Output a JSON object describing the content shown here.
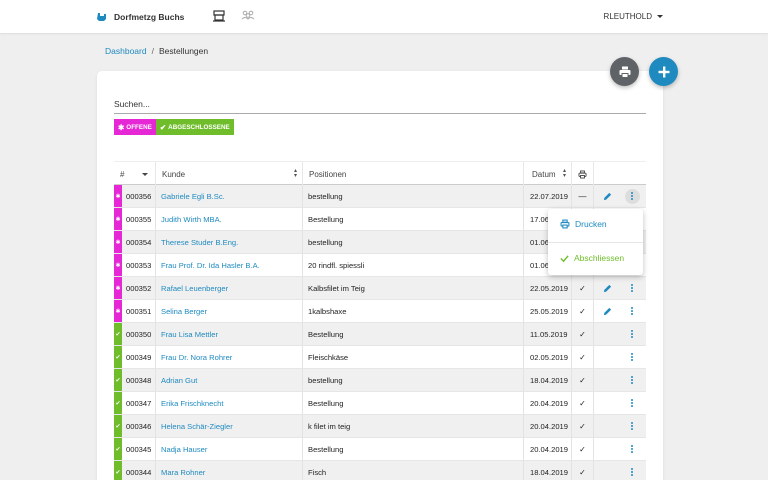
{
  "nav": {
    "brand": "Dorfmetzg Buchs",
    "user": "RLEUTHOLD"
  },
  "breadcrumb": {
    "home": "Dashboard",
    "separator": "/",
    "current": "Bestellungen"
  },
  "search": {
    "placeholder": "Suchen..."
  },
  "filters": {
    "open_label": "OFFENE",
    "closed_label": "ABGESCHLOSSENE"
  },
  "table": {
    "headers": {
      "number": "#",
      "customer": "Kunde",
      "positions": "Positionen",
      "date": "Datum"
    },
    "rows": [
      {
        "status": "open",
        "number": "000356",
        "customer": "Gabriele Egli B.Sc.",
        "positions": "bestellung",
        "date": "22.07.2019",
        "printed": "—",
        "editable": true,
        "menu_open": true
      },
      {
        "status": "open",
        "number": "000355",
        "customer": "Judith Wirth MBA.",
        "positions": "Bestellung",
        "date": "17.06",
        "printed": "",
        "editable": false
      },
      {
        "status": "open",
        "number": "000354",
        "customer": "Therese Studer B.Eng.",
        "positions": "bestellung",
        "date": "01.06",
        "printed": "",
        "editable": false
      },
      {
        "status": "open",
        "number": "000353",
        "customer": "Frau Prof. Dr. Ida Hasler B.A.",
        "positions": "20 rindfl. spiessli",
        "date": "01.06",
        "printed": "",
        "editable": false
      },
      {
        "status": "open",
        "number": "000352",
        "customer": "Rafael Leuenberger",
        "positions": "Kalbsfilet im Teig",
        "date": "22.05.2019",
        "printed": "✓",
        "editable": true
      },
      {
        "status": "open",
        "number": "000351",
        "customer": "Selina Berger",
        "positions": "1kalbshaxe",
        "date": "25.05.2019",
        "printed": "✓",
        "editable": true
      },
      {
        "status": "closed",
        "number": "000350",
        "customer": "Frau Lisa Mettler",
        "positions": "Bestellung",
        "date": "11.05.2019",
        "printed": "✓",
        "editable": false
      },
      {
        "status": "closed",
        "number": "000349",
        "customer": "Frau Dr. Nora Rohrer",
        "positions": "Fleischkäse",
        "date": "02.05.2019",
        "printed": "✓",
        "editable": false
      },
      {
        "status": "closed",
        "number": "000348",
        "customer": "Adrian Gut",
        "positions": "bestellung",
        "date": "18.04.2019",
        "printed": "✓",
        "editable": false
      },
      {
        "status": "closed",
        "number": "000347",
        "customer": "Erika Frischknecht",
        "positions": "Bestellung",
        "date": "20.04.2019",
        "printed": "✓",
        "editable": false
      },
      {
        "status": "closed",
        "number": "000346",
        "customer": "Helena Schär-Ziegler",
        "positions": "k filet im teig",
        "date": "20.04.2019",
        "printed": "✓",
        "editable": false
      },
      {
        "status": "closed",
        "number": "000345",
        "customer": "Nadja Hauser",
        "positions": "Bestellung",
        "date": "20.04.2019",
        "printed": "✓",
        "editable": false
      },
      {
        "status": "closed",
        "number": "000344",
        "customer": "Mara Rohner",
        "positions": "Fisch",
        "date": "18.04.2019",
        "printed": "✓",
        "editable": false
      }
    ]
  },
  "row_menu": {
    "print_label": "Drucken",
    "close_label": "Abschliessen"
  },
  "colors": {
    "accent": "#1f8ac0",
    "open": "#e627d6",
    "closed": "#6fbd2b"
  }
}
